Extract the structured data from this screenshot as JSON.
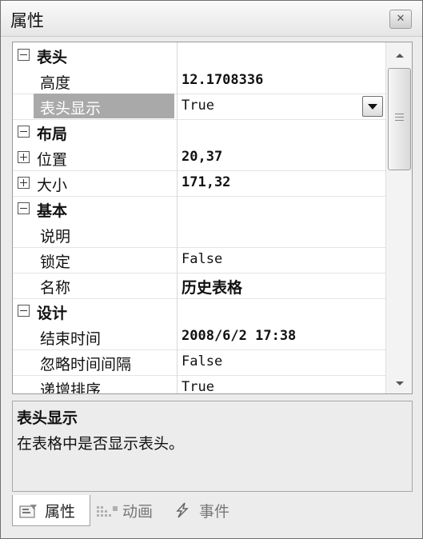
{
  "window": {
    "title": "属性",
    "close_icon": "close-icon"
  },
  "grid": {
    "categories": [
      {
        "label": "表头",
        "props": [
          {
            "name": "高度",
            "value": "12.1708336",
            "bold": true
          },
          {
            "name": "表头显示",
            "value": "True",
            "selected": true,
            "dropdown": true
          }
        ]
      },
      {
        "label": "布局",
        "props": [
          {
            "name": "位置",
            "value": "20,37",
            "bold": true,
            "expandable": true
          },
          {
            "name": "大小",
            "value": "171,32",
            "bold": true,
            "expandable": true
          }
        ]
      },
      {
        "label": "基本",
        "props": [
          {
            "name": "说明",
            "value": ""
          },
          {
            "name": "锁定",
            "value": "False"
          },
          {
            "name": "名称",
            "value": "历史表格",
            "bold": true
          }
        ]
      },
      {
        "label": "设计",
        "props": [
          {
            "name": "结束时间",
            "value": "2008/6/2 17:38",
            "bold": true
          },
          {
            "name": "忽略时间间隔",
            "value": "False"
          },
          {
            "name": "递增排序",
            "value": "True"
          }
        ]
      }
    ]
  },
  "description": {
    "title": "表头显示",
    "text": "在表格中是否显示表头。"
  },
  "tabs": [
    {
      "label": "属性",
      "icon": "properties-icon",
      "active": true
    },
    {
      "label": "动画",
      "icon": "animation-icon",
      "active": false
    },
    {
      "label": "事件",
      "icon": "lightning-icon",
      "active": false
    }
  ],
  "colors": {
    "selection": "#a9a9a9",
    "window_bg": "#ececec"
  }
}
